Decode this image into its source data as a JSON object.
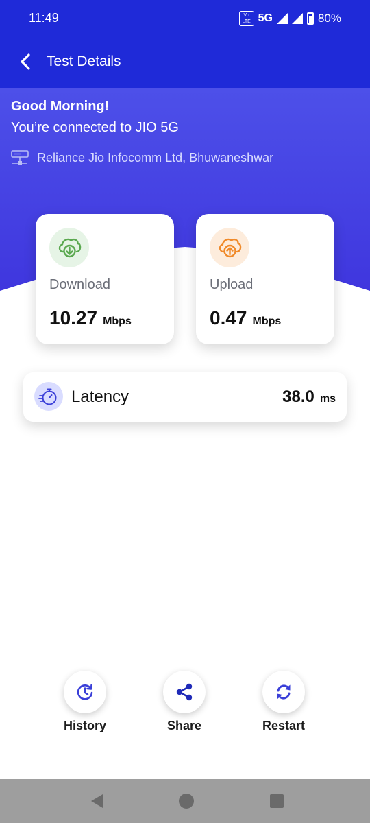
{
  "status_bar": {
    "time": "11:49",
    "volte": "Vo LTE",
    "network": "5G",
    "battery": "80%"
  },
  "header": {
    "title": "Test Details"
  },
  "hero": {
    "greeting": "Good Morning!",
    "connection": "You’re connected to JIO 5G",
    "isp": "Reliance Jio Infocomm Ltd, Bhuwaneshwar"
  },
  "download": {
    "label": "Download",
    "value": "10.27",
    "unit": "Mbps",
    "icon": "cloud-download-icon",
    "color": "#5aa84f"
  },
  "upload": {
    "label": "Upload",
    "value": "0.47",
    "unit": "Mbps",
    "icon": "cloud-upload-icon",
    "color": "#f08a2a"
  },
  "latency": {
    "label": "Latency",
    "value": "38.0",
    "unit": "ms",
    "icon": "stopwatch-icon"
  },
  "actions": [
    {
      "label": "History",
      "icon": "history-icon"
    },
    {
      "label": "Share",
      "icon": "share-icon"
    },
    {
      "label": "Restart",
      "icon": "restart-icon"
    }
  ],
  "colors": {
    "header": "#1f2ad8",
    "hero": "#4d50e9",
    "accent": "#3a3fd8"
  }
}
